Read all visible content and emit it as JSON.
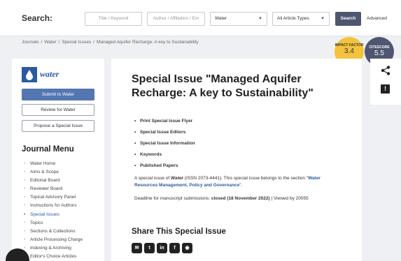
{
  "search": {
    "label": "Search:",
    "title_placeholder": "Title / Keyword",
    "author_placeholder": "Author / Affiliation / Em",
    "journal_value": "Water",
    "article_type_value": "All Article Types",
    "search_button": "Search",
    "advanced_link": "Advanced"
  },
  "breadcrumb": [
    "Journals",
    "Water",
    "Special Issues",
    "Managed Aquifer Recharge: A key to Sustainability"
  ],
  "badges": {
    "impact_factor_label": "IMPACT FACTOR",
    "impact_factor_value": "3.4",
    "citescore_label": "CITESCORE",
    "citescore_value": "5.5"
  },
  "sidebar": {
    "logo_text": "water",
    "submit_button": "Submit to Water",
    "review_button": "Review for Water",
    "propose_button": "Propose a Special Issue",
    "menu_title": "Journal Menu",
    "menu_items": [
      "Water Home",
      "Aims & Scope",
      "Editorial Board",
      "Reviewer Board",
      "Topical Advisory Panel",
      "Instructions for Authors",
      "Special Issues",
      "Topics",
      "Sections & Collections",
      "Article Processing Charge",
      "Indexing & Archiving",
      "Editor's Choice Articles"
    ]
  },
  "main": {
    "title": "Special Issue \"Managed Aquifer Recharge: A key to Sustainability\"",
    "links": [
      "Print Special Issue Flyer",
      "Special Issue Editors",
      "Special Issue Information",
      "Keywords",
      "Published Papers"
    ],
    "desc_prefix": "A special issue of ",
    "desc_journal": "Water",
    "desc_middle": " (ISSN 2073-4441). This special issue belongs to the section \"",
    "desc_section": "Water Resources Management, Policy and Governance",
    "desc_suffix": "\".",
    "deadline_prefix": "Deadline for manuscript submissions: ",
    "deadline_value": "closed (18 November 2022)",
    "deadline_suffix": " | Viewed by 20055",
    "share_title": "Share This Special Issue",
    "share_icons": [
      "email-icon",
      "twitter-icon",
      "linkedin-icon",
      "facebook-icon",
      "wechat-icon"
    ]
  },
  "colors": {
    "accent": "#4f5671",
    "brand_blue": "#2b5aa0",
    "impact_yellow": "#f3c33d",
    "button_blue": "#5477b2"
  }
}
